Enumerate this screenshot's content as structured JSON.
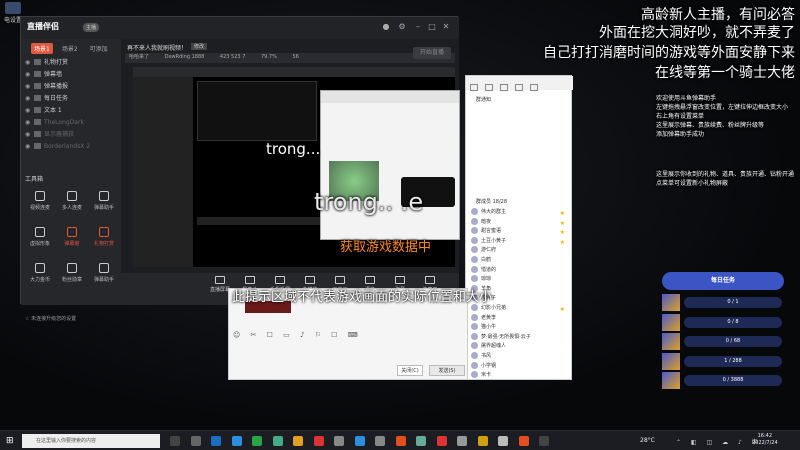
{
  "desktop": {
    "icon_label": "电设置"
  },
  "overlay": {
    "top_lines": [
      "高龄新人主播，有问必答",
      "外面在挖大洞好吵，就不弄麦了",
      "自己打打消磨时间的游戏等外面安静下来",
      "在线等第一个骑士大佬"
    ],
    "info1": [
      "欢迎使用斗鱼弹幕助手",
      "左键拖拽悬浮窗改变位置，左键拉伸边框改变大小",
      "右上角有设置菜单",
      "这里展示弹幕、贵族续费、粉丝牌升级等",
      "添加弹幕助手成功"
    ],
    "info2": [
      "这里展示你收到的礼物、道具、贵族开通、钻粉开通",
      "点菜单可设置新小礼物屏蔽"
    ],
    "center_text": "trong...",
    "center_text2": "trong.. .e",
    "loading": "获取游戏数据中",
    "bottom_hint": "此提示区域不代表游戏画面的实际位置和大小"
  },
  "app": {
    "title": "直播伴侣",
    "badge": "主播",
    "tabs": [
      "场景1",
      "场景2",
      "可添加"
    ],
    "sources": [
      {
        "label": "礼物打赏",
        "dim": false
      },
      {
        "label": "弹幕墙",
        "dim": false
      },
      {
        "label": "弹幕播报",
        "dim": false
      },
      {
        "label": "每日任务",
        "dim": false
      },
      {
        "label": "文本 1",
        "dim": false
      },
      {
        "label": "TheLongDark",
        "dim": true
      },
      {
        "label": "显示器捕获",
        "dim": true
      },
      {
        "label": "BorderlandsX 2",
        "dim": true
      }
    ],
    "tools_title": "工具箱",
    "tools": [
      "视频连麦",
      "多人连麦",
      "弹幕助手",
      "虚拟形象",
      "弹幕窗",
      "礼物打赏",
      "大力金币",
      "粉丝勋章",
      "弹幕助手"
    ],
    "status": "☆ 未连接升级您的设置",
    "stream_title": "再不来人我就刷视频！",
    "stream_title_btn": "修改",
    "info_row": [
      "哈哈来了",
      "DewRding 1888",
      "423 523 7",
      "79.7%",
      "56"
    ],
    "buttons": [
      "直播屏幕",
      "摄像头",
      "手机投屏",
      "多媒体",
      "画中画",
      "语音",
      "弹幕",
      "连麦平"
    ],
    "start_label": "开始直播"
  },
  "chat": {
    "notice": "群通知",
    "group": "群成员 18/28",
    "members": [
      "伟大的群主",
      "暗夜",
      "甜言蜜语",
      "土豆小黄子",
      "游仁府",
      "白鹤",
      "惜道的",
      "琼琼",
      "羊角",
      "浅胖子",
      "幻影小兄弟",
      "老黄李",
      "猫小牛",
      "梦·最强·无所畏惧·云子",
      "屠界超魂人",
      "书风",
      "小学钢",
      "米卡"
    ]
  },
  "dialog": {
    "close_label": "关闭(C)",
    "send_label": "发送(S)"
  },
  "tasks": {
    "title": "每日任务",
    "rows": [
      {
        "progress": "0 / 1"
      },
      {
        "progress": "0 / 8"
      },
      {
        "progress": "0 / 68"
      },
      {
        "progress": "1 / 288"
      },
      {
        "progress": "0 / 3888"
      }
    ]
  },
  "taskbar": {
    "search_placeholder": "在这里输入你要搜索的内容",
    "weather": "28°C",
    "time": "16:42",
    "date": "2022/7/24"
  },
  "colors": {
    "accent": "#e2583e",
    "loading": "#ff8a1e",
    "task": "#3b55c4"
  }
}
